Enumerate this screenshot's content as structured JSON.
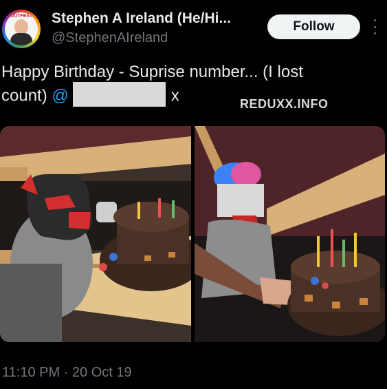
{
  "author": {
    "display_name": "Stephen A Ireland (He/Hi...",
    "handle": "@StephenAIreland",
    "avatar_label": "OUTFEST"
  },
  "follow_button": {
    "label": "Follow"
  },
  "tweet": {
    "text_line1": "Happy Birthday - Suprise number... (I lost",
    "text_line2_start": "count) ",
    "mention_prefix": "@",
    "text_end": "x"
  },
  "watermark": "REDUXX.INFO",
  "timestamp": "11:10 PM · 20 Oct 19",
  "images": {
    "left": "person-in-red-pup-mask-with-chocolate-cake",
    "right": "person-with-blue-pink-hair-and-red-bandana-lighting-cake"
  },
  "colors": {
    "background": "#000000",
    "text": "#e7e9ea",
    "muted": "#71767b",
    "link": "#1d9bf0",
    "follow_bg": "#eff3f4"
  }
}
